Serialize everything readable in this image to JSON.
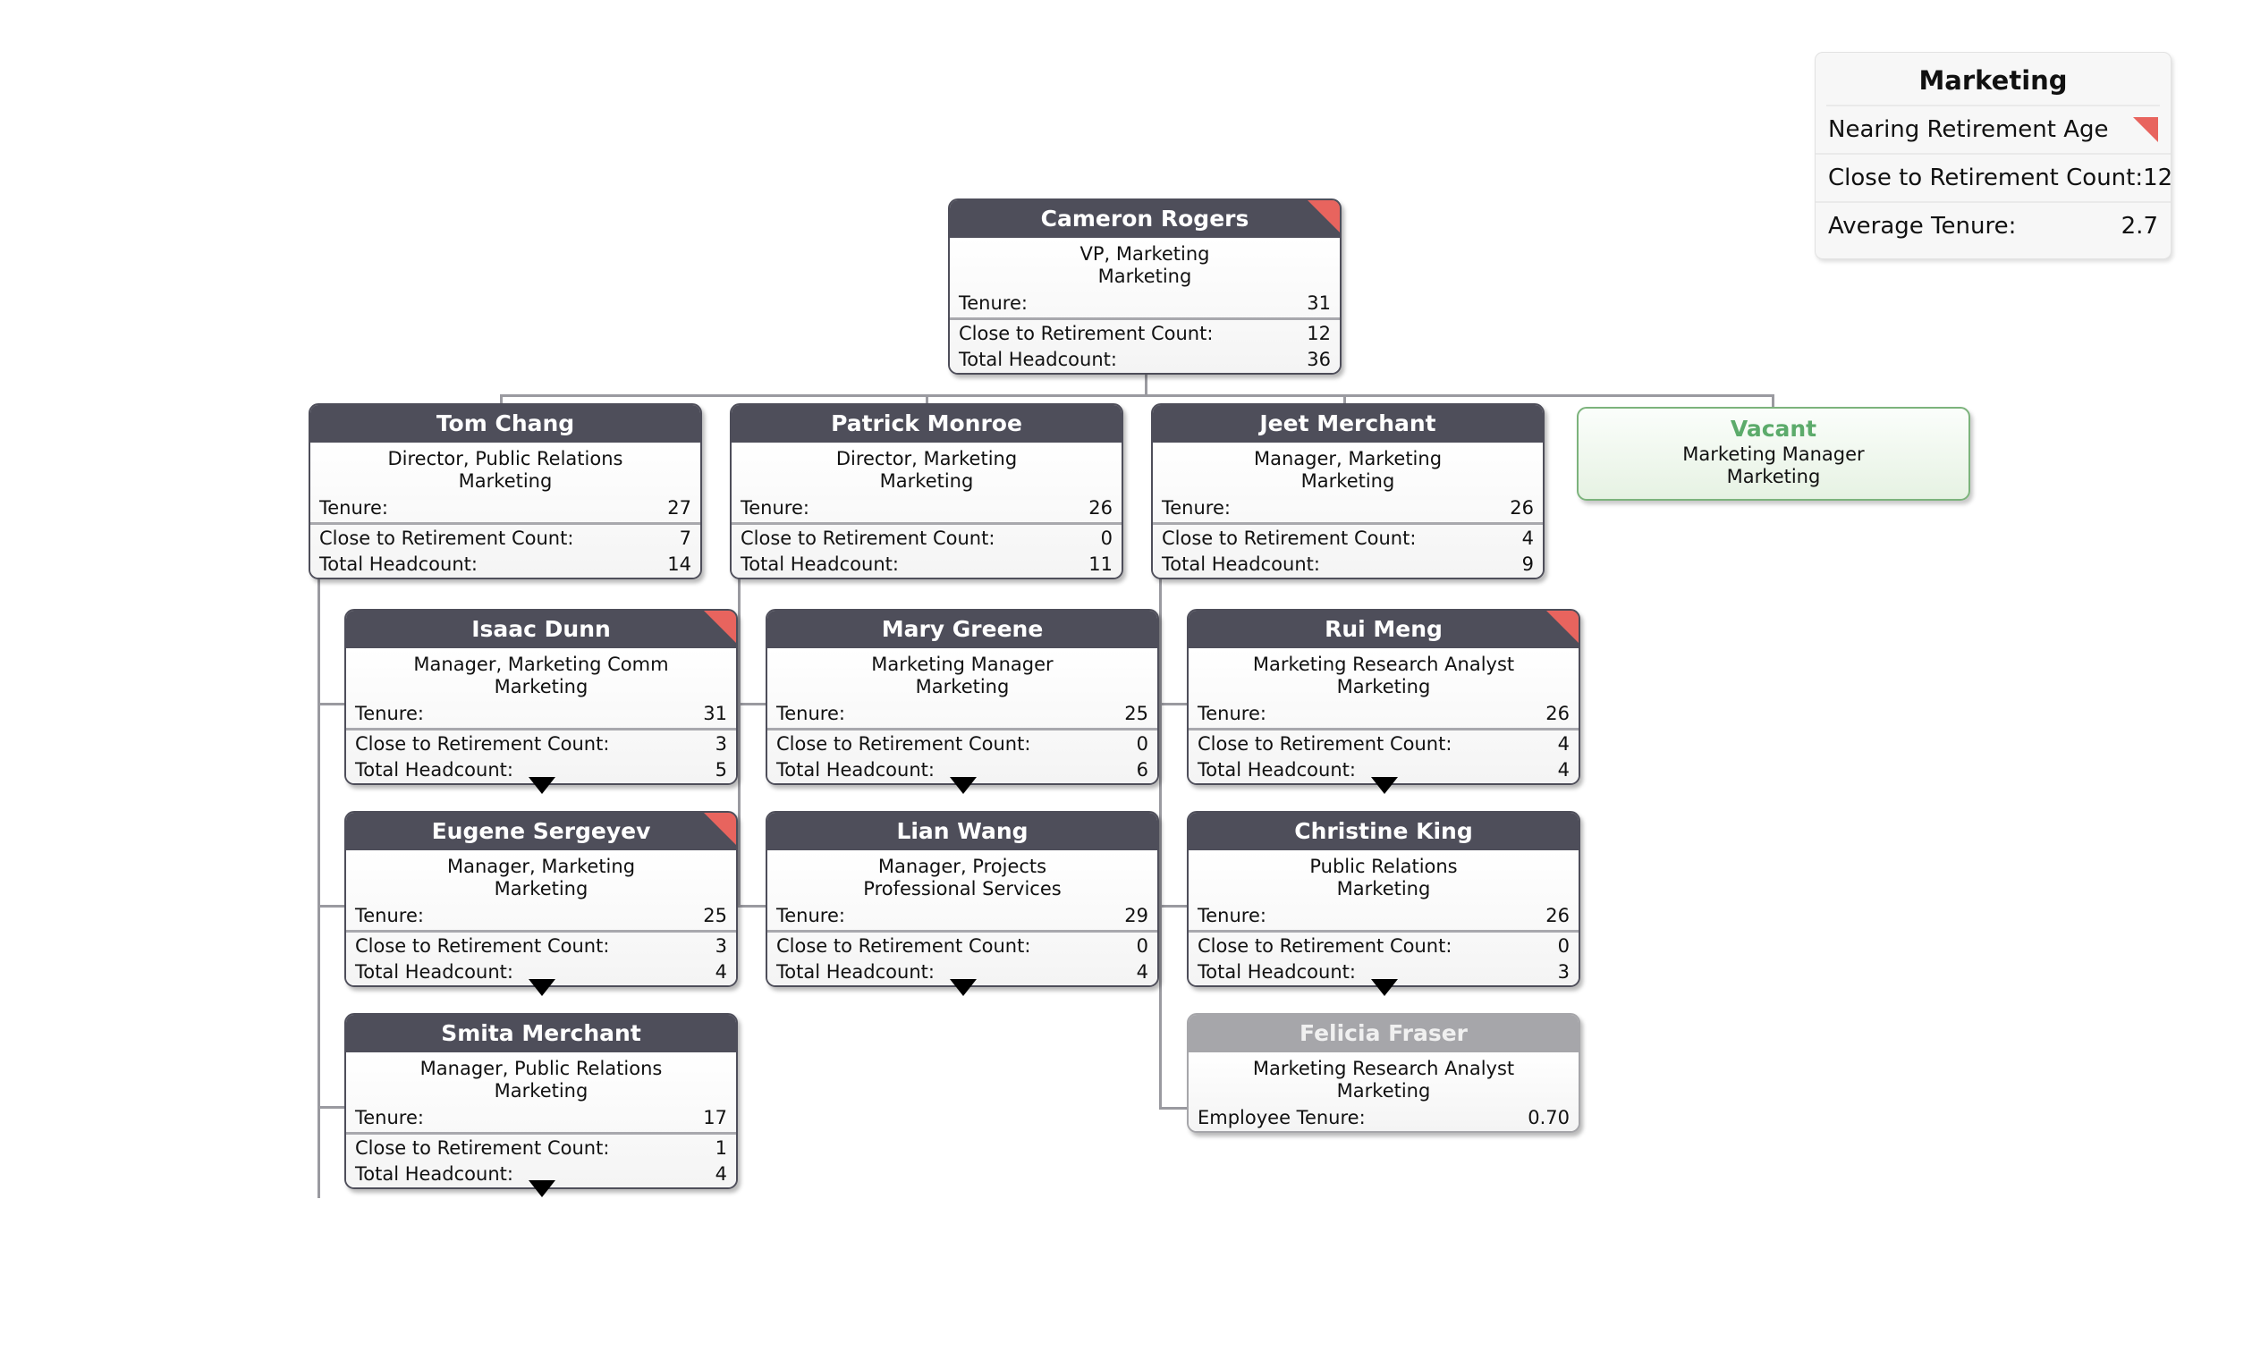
{
  "legend": {
    "title": "Marketing",
    "rows": [
      {
        "label": "Nearing Retirement Age",
        "value": "",
        "swatch": "red-corner-triangle-icon"
      },
      {
        "label": "Close to Retirement Count:",
        "value": "12"
      },
      {
        "label": "Average Tenure:",
        "value": "2.7"
      }
    ]
  },
  "labels": {
    "tenure": "Tenure:",
    "close_to_retirement": "Close to Retirement Count:",
    "total_headcount": "Total Headcount:",
    "employee_tenure": "Employee Tenure:"
  },
  "colors": {
    "header": "#4e4e5a",
    "header_inactive": "#a6a6aa",
    "flag_red": "#e8645e",
    "vacant_green": "#5cab6b",
    "vacant_border": "#7cb37c",
    "connector": "#9a9aa0"
  },
  "nodes": {
    "cameron_rogers": {
      "name": "Cameron Rogers",
      "title": "VP, Marketing",
      "department": "Marketing",
      "tenure": "31",
      "close_to_retirement": "12",
      "total_headcount": "36",
      "nearing_retirement": true
    },
    "tom_chang": {
      "name": "Tom Chang",
      "title": "Director, Public Relations",
      "department": "Marketing",
      "tenure": "27",
      "close_to_retirement": "7",
      "total_headcount": "14",
      "nearing_retirement": false
    },
    "patrick_monroe": {
      "name": "Patrick Monroe",
      "title": "Director, Marketing",
      "department": "Marketing",
      "tenure": "26",
      "close_to_retirement": "0",
      "total_headcount": "11",
      "nearing_retirement": false
    },
    "jeet_merchant": {
      "name": "Jeet Merchant",
      "title": "Manager, Marketing",
      "department": "Marketing",
      "tenure": "26",
      "close_to_retirement": "4",
      "total_headcount": "9",
      "nearing_retirement": false
    },
    "vacant": {
      "name": "Vacant",
      "title": "Marketing Manager",
      "department": "Marketing"
    },
    "isaac_dunn": {
      "name": "Isaac Dunn",
      "title": "Manager, Marketing Comm",
      "department": "Marketing",
      "tenure": "31",
      "close_to_retirement": "3",
      "total_headcount": "5",
      "nearing_retirement": true
    },
    "mary_greene": {
      "name": "Mary Greene",
      "title": "Marketing Manager",
      "department": "Marketing",
      "tenure": "25",
      "close_to_retirement": "0",
      "total_headcount": "6",
      "nearing_retirement": false
    },
    "rui_meng": {
      "name": "Rui Meng",
      "title": "Marketing Research Analyst",
      "department": "Marketing",
      "tenure": "26",
      "close_to_retirement": "4",
      "total_headcount": "4",
      "nearing_retirement": true
    },
    "eugene_sergeyev": {
      "name": "Eugene Sergeyev",
      "title": "Manager, Marketing",
      "department": "Marketing",
      "tenure": "25",
      "close_to_retirement": "3",
      "total_headcount": "4",
      "nearing_retirement": true
    },
    "lian_wang": {
      "name": "Lian Wang",
      "title": "Manager, Projects",
      "department": "Professional Services",
      "tenure": "29",
      "close_to_retirement": "0",
      "total_headcount": "4",
      "nearing_retirement": false
    },
    "christine_king": {
      "name": "Christine King",
      "title": "Public Relations",
      "department": "Marketing",
      "tenure": "26",
      "close_to_retirement": "0",
      "total_headcount": "3",
      "nearing_retirement": false
    },
    "smita_merchant": {
      "name": "Smita Merchant",
      "title": "Manager, Public Relations",
      "department": "Marketing",
      "tenure": "17",
      "close_to_retirement": "1",
      "total_headcount": "4",
      "nearing_retirement": false
    },
    "felicia_fraser": {
      "name": "Felicia Fraser",
      "title": "Marketing Research Analyst",
      "department": "Marketing",
      "employee_tenure": "0.70",
      "inactive": true
    }
  }
}
